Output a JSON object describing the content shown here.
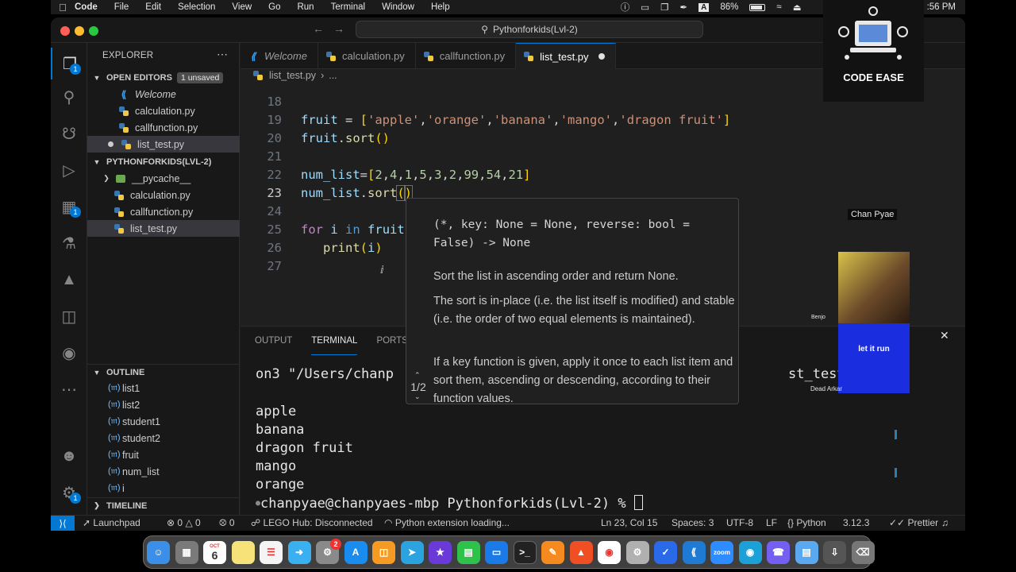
{
  "menubar": {
    "app_name": "Code",
    "items": [
      "File",
      "Edit",
      "Selection",
      "View",
      "Go",
      "Run",
      "Terminal",
      "Window",
      "Help"
    ],
    "battery": "86%",
    "clock": ":56 PM"
  },
  "window": {
    "search_title": "Pythonforkids(Lvl-2)"
  },
  "sidebar": {
    "title": "EXPLORER",
    "open_editors_label": "OPEN EDITORS",
    "unsaved_badge": "1 unsaved",
    "open_editors": [
      {
        "label": "Welcome",
        "type": "vscode"
      },
      {
        "label": "calculation.py",
        "type": "python"
      },
      {
        "label": "callfunction.py",
        "type": "python"
      },
      {
        "label": "list_test.py",
        "type": "python",
        "modified": true
      }
    ],
    "project_label": "PYTHONFORKIDS(LVL-2)",
    "files": [
      {
        "label": "__pycache__",
        "type": "folder"
      },
      {
        "label": "calculation.py",
        "type": "python"
      },
      {
        "label": "callfunction.py",
        "type": "python"
      },
      {
        "label": "list_test.py",
        "type": "python",
        "selected": true
      }
    ],
    "outline_label": "OUTLINE",
    "outline": [
      "list1",
      "list2",
      "student1",
      "student2",
      "fruit",
      "num_list",
      "i"
    ],
    "timeline_label": "TIMELINE"
  },
  "activity_badges": {
    "explorer": "1",
    "extensions": "1",
    "settings": "1"
  },
  "tabs": [
    {
      "label": "Welcome",
      "italic": true,
      "icon": "vscode"
    },
    {
      "label": "calculation.py",
      "icon": "python"
    },
    {
      "label": "callfunction.py",
      "icon": "python"
    },
    {
      "label": "list_test.py",
      "icon": "python",
      "active": true,
      "dirty": true
    }
  ],
  "breadcrumb": {
    "file": "list_test.py",
    "more": "..."
  },
  "editor": {
    "line_numbers": [
      "18",
      "19",
      "20",
      "21",
      "22",
      "23",
      "24",
      "25",
      "26",
      "27"
    ],
    "current_line": "23"
  },
  "hover": {
    "signature": "(*, key: None = None, reverse: bool = False) -> None",
    "paragraphs": [
      "Sort the list in ascending order and return None.",
      "The sort is in-place (i.e. the list itself is modified) and stable (i.e. the order of two equal elements is maintained).",
      "If a key function is given, apply it once to each list item and sort them, ascending or descending, according to their function values."
    ],
    "pager": "1/2"
  },
  "panel": {
    "tabs": [
      "OUTPUT",
      "TERMINAL",
      "PORTS"
    ],
    "active_tab": "TERMINAL",
    "terminal_lines": [
      "on3 \"/Users/chanp",
      "st_test.p",
      "apple",
      "banana",
      "dragon fruit",
      "mango",
      "orange"
    ],
    "prompt": "chanpyae@chanpyaes-mbp Pythonforkids(Lvl-2) % "
  },
  "statusbar": {
    "launchpad": "Launchpad",
    "errors": "0",
    "warnings": "0",
    "ports": "0",
    "lego": "LEGO Hub: Disconnected",
    "python_loading": "Python extension loading...",
    "position": "Ln 23, Col 15",
    "spaces": "Spaces: 3",
    "encoding": "UTF-8",
    "eol": "LF",
    "language": "Python",
    "version": "3.12.3",
    "prettier": "Prettier"
  },
  "overlay": {
    "brand": "CODE EASE",
    "participant_name": "Chan Pyae",
    "video_caption": "let it run",
    "participant_2": "Dead Arkar",
    "participant_3": "Benjo"
  },
  "dock": {
    "calendar_day": "6",
    "calendar_month": "OCT",
    "zoom_label": "zoom",
    "mail_badge": "1",
    "settings_badge": "2"
  }
}
